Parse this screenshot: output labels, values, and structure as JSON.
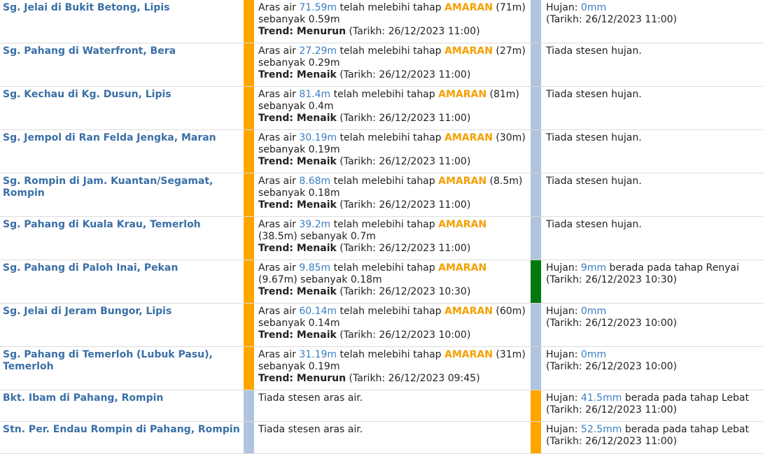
{
  "colors": {
    "warning": "#FFA500",
    "normal": "#B0C4DE",
    "light_rain": "#007A0F",
    "heavy_rain": "#FFA500",
    "link": "#3A6FA6",
    "value": "#3A7FC1"
  },
  "rows": [
    {
      "station": "Sg. Jelai di Bukit Betong, Lipis",
      "level": {
        "pre": "Aras air ",
        "value": "71.59m",
        "mid": " telah melebihi tahap ",
        "status": "AMARAN",
        "post": " (71m) sebanyak 0.59m",
        "trend_label": "Trend: Menurun",
        "date": " (Tarikh: 26/12/2023 11:00)"
      },
      "rain": {
        "label": "Hujan: ",
        "value": "0mm",
        "post": "",
        "date": "(Tarikh: 26/12/2023 11:00)"
      }
    },
    {
      "station": "Sg. Pahang di Waterfront, Bera",
      "level": {
        "pre": "Aras air ",
        "value": "27.29m",
        "mid": " telah melebihi tahap ",
        "status": "AMARAN",
        "post": " (27m) sebanyak 0.29m",
        "trend_label": "Trend: Menaik",
        "date": " (Tarikh: 26/12/2023 11:00)"
      },
      "rain": {
        "none": "Tiada stesen hujan."
      }
    },
    {
      "station": "Sg. Kechau di Kg. Dusun, Lipis",
      "level": {
        "pre": "Aras air ",
        "value": "81.4m",
        "mid": " telah melebihi tahap ",
        "status": "AMARAN",
        "post": "  (81m) sebanyak 0.4m",
        "trend_label": "Trend: Menaik",
        "date": " (Tarikh: 26/12/2023 11:00)"
      },
      "rain": {
        "none": "Tiada stesen hujan."
      }
    },
    {
      "station": "Sg. Jempol di Ran Felda Jengka, Maran",
      "level": {
        "pre": "Aras air ",
        "value": "30.19m",
        "mid": " telah melebihi tahap ",
        "status": "AMARAN",
        "post": " (30m) sebanyak 0.19m",
        "trend_label": "Trend: Menaik",
        "date": " (Tarikh: 26/12/2023 11:00)"
      },
      "rain": {
        "none": "Tiada stesen hujan."
      }
    },
    {
      "station": "Sg. Rompin di Jam. Kuantan/Segamat, Rompin",
      "level": {
        "pre": "Aras air ",
        "value": "8.68m",
        "mid": " telah melebihi tahap ",
        "status": "AMARAN",
        "post": " (8.5m) sebanyak 0.18m",
        "trend_label": "Trend: Menaik",
        "date": " (Tarikh: 26/12/2023 11:00)"
      },
      "rain": {
        "none": "Tiada stesen hujan."
      }
    },
    {
      "station": "Sg. Pahang di Kuala Krau, Temerloh",
      "level": {
        "pre": "Aras air ",
        "value": "39.2m",
        "mid": " telah melebihi tahap ",
        "status": "AMARAN",
        "post": " (38.5m) sebanyak 0.7m",
        "trend_label": "Trend: Menaik",
        "date": " (Tarikh: 26/12/2023 11:00)"
      },
      "rain": {
        "none": "Tiada stesen hujan."
      }
    },
    {
      "station": "Sg. Pahang di Paloh Inai, Pekan",
      "level": {
        "pre": "Aras air ",
        "value": "9.85m",
        "mid": " telah melebihi tahap ",
        "status": "AMARAN",
        "post": " (9.67m) sebanyak 0.18m",
        "trend_label": "Trend: Menaik",
        "date": " (Tarikh: 26/12/2023 10:30)"
      },
      "rain": {
        "label": "Hujan: ",
        "value": "9mm",
        "post": " berada pada tahap Renyai",
        "date": "(Tarikh: 26/12/2023 10:30)"
      }
    },
    {
      "station": "Sg. Jelai di Jeram Bungor, Lipis",
      "level": {
        "pre": "Aras air ",
        "value": "60.14m",
        "mid": " telah melebihi tahap ",
        "status": "AMARAN",
        "post": " (60m) sebanyak 0.14m",
        "trend_label": "Trend: Menaik",
        "date": " (Tarikh: 26/12/2023 10:00)"
      },
      "rain": {
        "label": "Hujan: ",
        "value": "0mm",
        "post": "",
        "date": "(Tarikh: 26/12/2023 10:00)"
      }
    },
    {
      "station": "Sg. Pahang di Temerloh (Lubuk Pasu), Temerloh",
      "level": {
        "pre": "Aras air ",
        "value": "31.19m",
        "mid": " telah melebihi tahap ",
        "status": "AMARAN",
        "post": " (31m) sebanyak 0.19m",
        "trend_label": "Trend: Menurun",
        "date": " (Tarikh: 26/12/2023 09:45)"
      },
      "rain": {
        "label": "Hujan: ",
        "value": "0mm",
        "post": "",
        "date": "(Tarikh: 26/12/2023 10:00)"
      }
    },
    {
      "station": "Bkt. Ibam di Pahang, Rompin",
      "level": {
        "none": "Tiada stesen aras air."
      },
      "rain": {
        "label": "Hujan: ",
        "value": "41.5mm",
        "post": " berada pada tahap Lebat",
        "date": "(Tarikh: 26/12/2023 11:00)"
      }
    },
    {
      "station": "Stn. Per. Endau Rompin di Pahang, Rompin",
      "level": {
        "none": "Tiada stesen aras air."
      },
      "rain": {
        "label": "Hujan: ",
        "value": "52.5mm",
        "post": " berada pada tahap Lebat",
        "date": "(Tarikh: 26/12/2023 11:00)"
      }
    }
  ]
}
